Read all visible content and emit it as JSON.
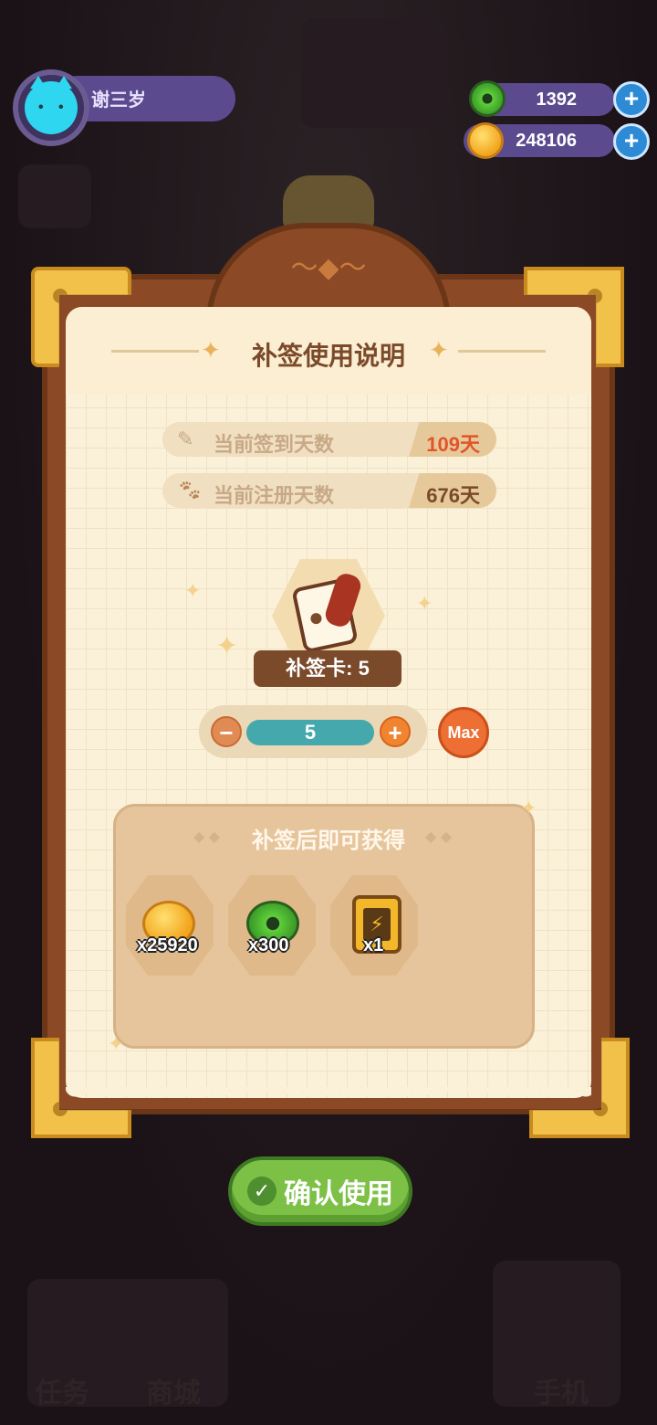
{
  "user": {
    "name": "谢三岁"
  },
  "currencies": [
    {
      "value": "1392",
      "icon": "green-donut-icon"
    },
    {
      "value": "248106",
      "icon": "gold-coin-icon"
    }
  ],
  "dialog": {
    "title": "补签使用说明",
    "stats": [
      {
        "label": "当前签到天数",
        "value": "109天",
        "icon": "pencil-icon",
        "color": "#e2542a"
      },
      {
        "label": "当前注册天数",
        "value": "676天",
        "icon": "paw-icon",
        "color": "#7a4a2a"
      }
    ],
    "card_label": "补签卡: 5",
    "stepper_value": "5",
    "max_label": "Max",
    "rewards_title": "补签后即可获得",
    "rewards": [
      {
        "count": "x25920",
        "icon": "gold-coin-icon"
      },
      {
        "count": "x300",
        "icon": "green-donut-icon"
      },
      {
        "count": "x1",
        "icon": "battery-icon"
      }
    ],
    "confirm_label": "确认使用"
  },
  "background_labels": [
    "任务",
    "商城",
    "手机"
  ]
}
